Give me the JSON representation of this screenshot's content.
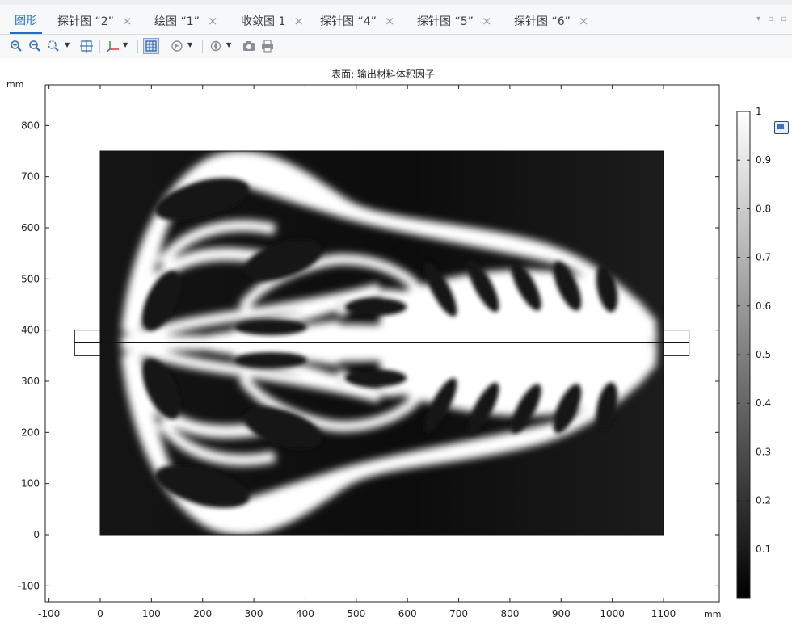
{
  "tabs": [
    {
      "label": "图形",
      "active": true,
      "closable": false
    },
    {
      "label": "探针图 “2”",
      "closable": true
    },
    {
      "label": "绘图 “1”",
      "closable": true
    },
    {
      "label": "收敛图 1",
      "closable": true
    },
    {
      "label": "探针图 “4”",
      "closable": true
    },
    {
      "label": "探针图 “5”",
      "closable": true
    },
    {
      "label": "探针图 “6”",
      "closable": true
    }
  ],
  "toolbar": {
    "icons": [
      "zoom-in-icon",
      "zoom-out-icon",
      "zoom-box-icon",
      "zoom-extents-icon",
      "axis-orientation-icon",
      "grid-toggle-icon",
      "select-icon",
      "scene-light-icon",
      "camera-icon",
      "print-icon"
    ]
  },
  "plot": {
    "title": "表面: 输出材料体积因子",
    "x_unit": "mm",
    "y_unit": "mm",
    "x_ticks": [
      "-100",
      "0",
      "100",
      "200",
      "300",
      "400",
      "500",
      "600",
      "700",
      "800",
      "900",
      "1000",
      "1100"
    ],
    "y_ticks": [
      "800",
      "700",
      "600",
      "500",
      "400",
      "300",
      "200",
      "100",
      "0",
      "-100"
    ],
    "x_range": [
      -110,
      1210
    ],
    "y_range": [
      -130,
      880
    ],
    "domain": {
      "x": [
        0,
        1100
      ],
      "y": [
        0,
        750
      ]
    },
    "ports": [
      {
        "x": [
          -50,
          0
        ],
        "y": [
          350,
          400
        ]
      },
      {
        "x": [
          1100,
          1150
        ],
        "y": [
          350,
          400
        ]
      }
    ],
    "symmetry_line_y": 375
  },
  "colorbar": {
    "ticks": [
      "1",
      "0.9",
      "0.8",
      "0.7",
      "0.6",
      "0.5",
      "0.4",
      "0.3",
      "0.2",
      "0.1"
    ],
    "range": [
      0,
      1
    ]
  }
}
